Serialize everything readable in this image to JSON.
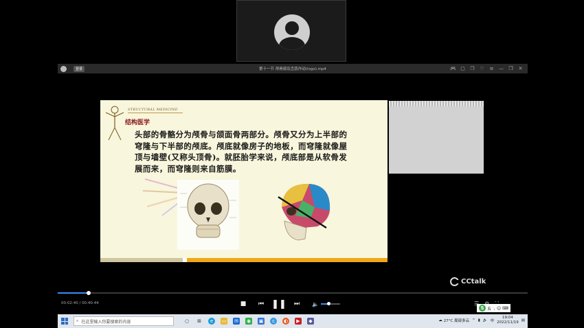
{
  "player": {
    "title": "第十一节 颅骨颌及舌肌作动(logo).mp4",
    "login_label": "登录"
  },
  "slide": {
    "brand_en": "STRUCTURAL MEDICINE",
    "brand_zh": "结构医学",
    "paragraph": "头部的骨骼分为颅骨与颌面骨两部分。颅骨又分为上半部的穹隆与下半部的颅底。颅底就像房子的地板，而穹隆就像屋顶与墙壁(又称头顶骨)。就胚胎学来说，颅底部是从软骨发展而来，而穹隆则来自筋膜。"
  },
  "brand_overlay": "CCtalk",
  "playback": {
    "current": "00:02:40",
    "total": "00:40:44",
    "progress_fraction": 0.066,
    "volume_fraction": 0.4
  },
  "taskbar": {
    "search_placeholder": "在这里输入你要搜索的内容",
    "weather": "27°C 局部多云",
    "time": "19:04",
    "date": "2022/11/19"
  },
  "ime": {
    "logo": "S",
    "mode": "五"
  },
  "colors": {
    "accent": "#3a8ef0",
    "slide_bg": "#f8f6dc",
    "slide_stripe": "#f0a818"
  }
}
